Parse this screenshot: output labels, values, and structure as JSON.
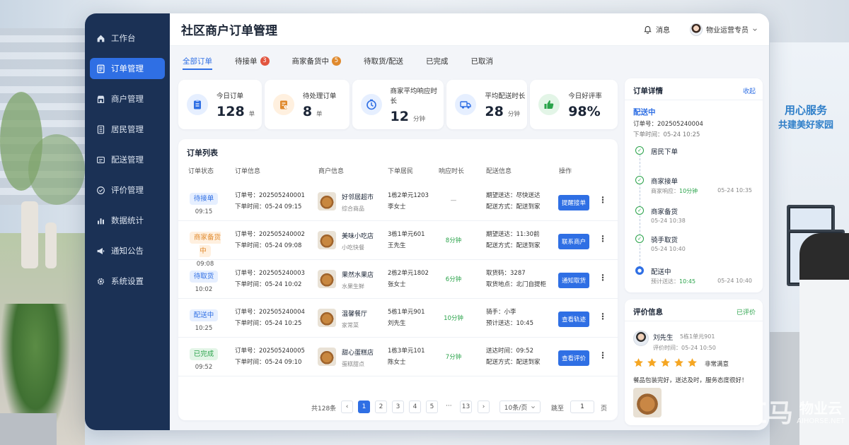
{
  "page": {
    "title": "社区商户订单管理"
  },
  "colors": {
    "primary": "#2f6fe4",
    "sidebar": "#1b3155",
    "green": "#2aa34a",
    "orange": "#e08a2e",
    "red": "#e2553f"
  },
  "sidebar": {
    "items": [
      {
        "label": "工作台",
        "icon": "home-icon",
        "active": false
      },
      {
        "label": "订单管理",
        "icon": "order-list-icon",
        "active": true
      },
      {
        "label": "商户管理",
        "icon": "store-icon",
        "active": false
      },
      {
        "label": "居民管理",
        "icon": "residents-icon",
        "active": false
      },
      {
        "label": "配送管理",
        "icon": "delivery-icon",
        "active": false
      },
      {
        "label": "评价管理",
        "icon": "shield-check-icon",
        "active": false
      },
      {
        "label": "数据统计",
        "icon": "bar-chart-icon",
        "active": false
      },
      {
        "label": "通知公告",
        "icon": "megaphone-icon",
        "active": false
      },
      {
        "label": "系统设置",
        "icon": "gear-icon",
        "active": false
      }
    ]
  },
  "header": {
    "messages_label": "消息",
    "user_name": "物业运营专员"
  },
  "tabs": [
    {
      "label": "全部订单",
      "badge": "",
      "badge_color": ""
    },
    {
      "label": "待接单",
      "badge": "3",
      "badge_color": "#e2553f"
    },
    {
      "label": "商家备货中",
      "badge": "5",
      "badge_color": "#e08a2e"
    },
    {
      "label": "待取货/配送",
      "badge": "",
      "badge_color": ""
    },
    {
      "label": "已完成",
      "badge": "",
      "badge_color": ""
    },
    {
      "label": "已取消",
      "badge": "",
      "badge_color": ""
    }
  ],
  "stats": [
    {
      "label": "今日订单",
      "value": "128",
      "unit": "单",
      "icon": "clipboard-icon",
      "color": "#2f6fe4",
      "bg": "#e6efff"
    },
    {
      "label": "待处理订单",
      "value": "8",
      "unit": "单",
      "icon": "pending-doc-icon",
      "color": "#e08a2e",
      "bg": "#fff0df"
    },
    {
      "label": "商家平均响应时长",
      "value": "12",
      "unit": "分钟",
      "icon": "clock-icon",
      "color": "#2f6fe4",
      "bg": "#e6efff"
    },
    {
      "label": "平均配送时长",
      "value": "28",
      "unit": "分钟",
      "icon": "truck-icon",
      "color": "#2f6fe4",
      "bg": "#e6efff"
    },
    {
      "label": "今日好评率",
      "value": "98%",
      "unit": "",
      "icon": "thumbs-up-icon",
      "color": "#2aa34a",
      "bg": "#e3f5e7"
    }
  ],
  "orders": {
    "title": "订单列表",
    "columns": [
      "订单状态",
      "订单信息",
      "商户信息",
      "下单居民",
      "响应时长",
      "配送信息",
      "操作"
    ],
    "rows": [
      {
        "status": "待接单",
        "status_color": "#2f6fe4",
        "status_bg": "#e6efff",
        "status_time": "09:15",
        "order_no": "订单号：202505240001",
        "order_time": "下单时间：05-24 09:15",
        "merchant": "好邻居超市",
        "category": "综合商品",
        "resident_addr": "1栋2单元1203",
        "resident_name": "李女士",
        "response": "—",
        "response_color": "#888888",
        "delivery_1": "期望送达：尽快送达",
        "delivery_2": "配送方式：配送到家",
        "action": "提醒接单"
      },
      {
        "status": "商家备货中",
        "status_color": "#e08a2e",
        "status_bg": "#fff0df",
        "status_time": "09:08",
        "order_no": "订单号：202505240002",
        "order_time": "下单时间：05-24 09:08",
        "merchant": "美味小吃店",
        "category": "小吃快餐",
        "resident_addr": "3栋1单元601",
        "resident_name": "王先生",
        "response": "8分钟",
        "response_color": "#2aa34a",
        "delivery_1": "期望送达：11:30前",
        "delivery_2": "配送方式：配送到家",
        "action": "联系商户"
      },
      {
        "status": "待取货",
        "status_color": "#2f6fe4",
        "status_bg": "#e6efff",
        "status_time": "10:02",
        "order_no": "订单号：202505240003",
        "order_time": "下单时间：05-24 10:02",
        "merchant": "果然水果店",
        "category": "水果生鲜",
        "resident_addr": "2栋2单元1802",
        "resident_name": "张女士",
        "response": "6分钟",
        "response_color": "#2aa34a",
        "delivery_1": "取货码：3287",
        "delivery_2": "取货地点：北门自提柜",
        "action": "通知取货"
      },
      {
        "status": "配送中",
        "status_color": "#2f6fe4",
        "status_bg": "#e6efff",
        "status_time": "10:25",
        "order_no": "订单号：202505240004",
        "order_time": "下单时间：05-24 10:25",
        "merchant": "温馨餐厅",
        "category": "家常菜",
        "resident_addr": "5栋1单元901",
        "resident_name": "刘先生",
        "response": "10分钟",
        "response_color": "#2aa34a",
        "delivery_1": "骑手：小李",
        "delivery_2": "预计送达：10:45",
        "action": "查看轨迹"
      },
      {
        "status": "已完成",
        "status_color": "#2aa34a",
        "status_bg": "#e3f5e7",
        "status_time": "09:52",
        "order_no": "订单号：202505240005",
        "order_time": "下单时间：05-24 09:10",
        "merchant": "甜心蛋糕店",
        "category": "蛋糕甜点",
        "resident_addr": "1栋3单元101",
        "resident_name": "陈女士",
        "response": "7分钟",
        "response_color": "#2aa34a",
        "delivery_1": "送达时间：09:52",
        "delivery_2": "配送方式：配送到家",
        "action": "查看评价"
      }
    ]
  },
  "pagination": {
    "total": "共128条",
    "pages": [
      "1",
      "2",
      "3",
      "4",
      "5"
    ],
    "ellipsis": "···",
    "last": "13",
    "current": "1",
    "page_size": "10条/页",
    "jump_label": "跳至",
    "jump_value": "1",
    "page_unit": "页"
  },
  "detail": {
    "title": "订单详情",
    "collapse": "收起",
    "status": "配送中",
    "order_no": "订单号：202505240004",
    "order_time": "下单时间：05-24 10:25",
    "steps": [
      {
        "name": "居民下单",
        "sub": "",
        "sub_hl": "",
        "time": ""
      },
      {
        "name": "商家接单",
        "sub": "商家响应：",
        "sub_hl": "10分钟",
        "time": "05-24 10:35"
      },
      {
        "name": "商家备货",
        "sub": "05-24 10:38",
        "sub_hl": "",
        "time": ""
      },
      {
        "name": "骑手取货",
        "sub": "05-24 10:40",
        "sub_hl": "",
        "time": ""
      },
      {
        "name": "配送中",
        "sub": "预计送达：",
        "sub_hl": "10:45",
        "time": "05-24 10:40"
      }
    ]
  },
  "review": {
    "title": "评价信息",
    "status": "已评价",
    "name": "刘先生",
    "address": "5栋1单元901",
    "time": "评价时间：05-24 10:50",
    "stars": 5,
    "rating_text": "非常满意",
    "text": "餐品包装完好，送达及时，服务态度很好！"
  },
  "background": {
    "slogan_line1": "用心服务",
    "slogan_line2": "共建美好家园",
    "watermark_main": "小红马",
    "watermark_right": "物业云",
    "watermark_url": "AIHORSE.NET"
  }
}
